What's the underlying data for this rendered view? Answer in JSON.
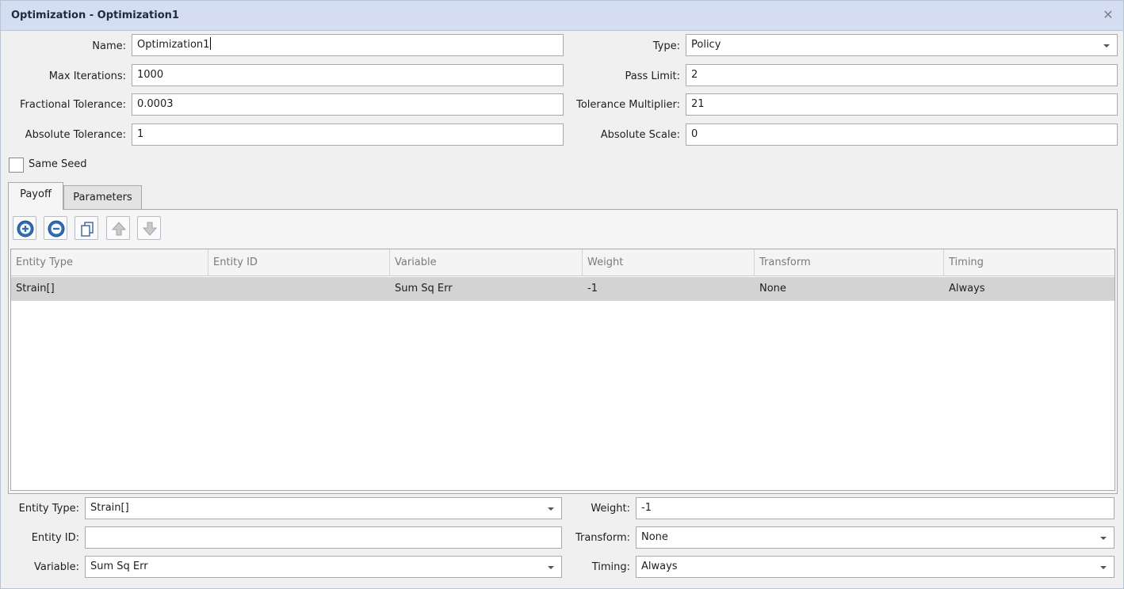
{
  "window": {
    "title": "Optimization - Optimization1",
    "close_glyph": "✕"
  },
  "form": {
    "name": {
      "label": "Name:",
      "value": "Optimization1"
    },
    "type": {
      "label": "Type:",
      "value": "Policy"
    },
    "max_iterations": {
      "label": "Max Iterations:",
      "value": "1000"
    },
    "pass_limit": {
      "label": "Pass Limit:",
      "value": "2"
    },
    "fractional_tolerance": {
      "label": "Fractional Tolerance:",
      "value": "0.0003"
    },
    "tolerance_multiplier": {
      "label": "Tolerance Multiplier:",
      "value": "21"
    },
    "absolute_tolerance": {
      "label": "Absolute Tolerance:",
      "value": "1"
    },
    "absolute_scale": {
      "label": "Absolute Scale:",
      "value": "0"
    },
    "same_seed": {
      "label": "Same Seed",
      "checked": false
    }
  },
  "tabs": [
    {
      "label": "Payoff",
      "active": true
    },
    {
      "label": "Parameters",
      "active": false
    }
  ],
  "toolbar": {
    "icons": [
      "add-icon",
      "remove-icon",
      "copy-icon",
      "move-up-icon",
      "move-down-icon"
    ]
  },
  "table": {
    "columns": [
      "Entity Type",
      "Entity ID",
      "Variable",
      "Weight",
      "Transform",
      "Timing"
    ],
    "rows": [
      [
        "Strain[]",
        "",
        "Sum Sq Err",
        "-1",
        "None",
        "Always"
      ]
    ]
  },
  "detail": {
    "entity_type": {
      "label": "Entity Type:",
      "value": "Strain[]"
    },
    "entity_id": {
      "label": "Entity ID:",
      "value": ""
    },
    "variable": {
      "label": "Variable:",
      "value": "Sum Sq Err"
    },
    "weight": {
      "label": "Weight:",
      "value": "-1"
    },
    "transform": {
      "label": "Transform:",
      "value": "None"
    },
    "timing": {
      "label": "Timing:",
      "value": "Always"
    }
  },
  "colors": {
    "titlebar": "#d4ddf2",
    "selected_row": "#d3d3d3",
    "toolbar_blue": "#2f6db5"
  }
}
